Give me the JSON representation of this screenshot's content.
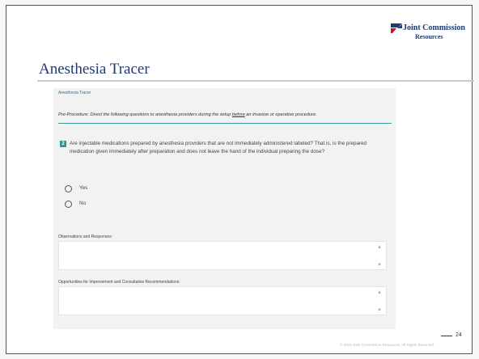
{
  "logo": {
    "line1": "Joint Commission",
    "line2": "Resources",
    "colors": {
      "navy": "#1f3a6e",
      "red": "#c8102e"
    }
  },
  "slide": {
    "title": "Anesthesia Tracer",
    "page_number": "24",
    "copyright": "© 2018 Joint Commission Resources. All Rights Reserved."
  },
  "form": {
    "breadcrumb": "Anesthesia Tracer",
    "preproc": {
      "before": "Pre-Procedure: Direct the following questions to anesthesia providers during the setup ",
      "underlined": "before",
      "after": " an invasive or operative procedure."
    },
    "question": {
      "number": "2",
      "text": "Are injectable medications prepared by anesthesia providers that are not immediately administered labeled? That is, is the prepared medication given immediately after preparation and does not leave the hand of the individual preparing the dose?"
    },
    "options": [
      "Yes",
      "No"
    ],
    "observations_label": "Observations and Responses:",
    "opportunities_label": "Opportunities for Improvement and Consultative Recommendations:",
    "accent": "#2a9b8f"
  }
}
